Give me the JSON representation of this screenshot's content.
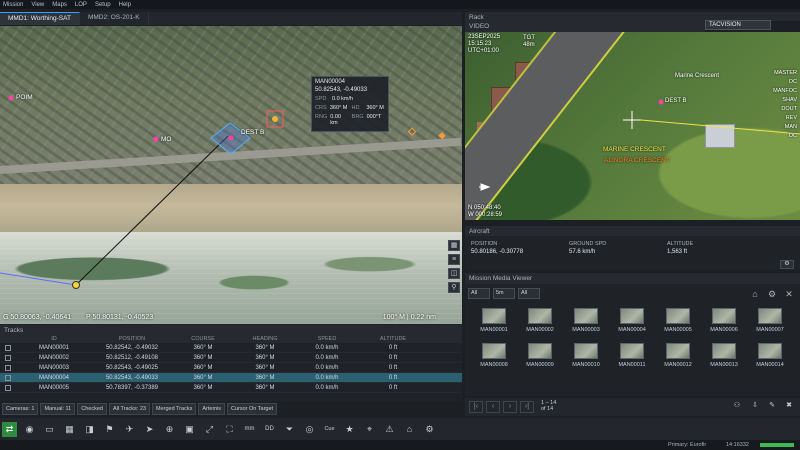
{
  "menu": [
    "Mission",
    "View",
    "Maps",
    "LOP",
    "Setup",
    "Help"
  ],
  "map_tabs": [
    "MMD1: Worthing-SAT",
    "MMD2: OS-201-K"
  ],
  "map": {
    "labels": {
      "poim": "POIM",
      "mo": "MO",
      "dest": "DEST B"
    },
    "popup": {
      "title": "MAN00004",
      "position": "50.82543, -0.49033",
      "spd_k": "SPD",
      "spd_v": "0.0 km/h",
      "crs_k": "CRS",
      "crs_v": "360° M",
      "hd_k": "HD",
      "hd_v": "360° M",
      "rng_k": "RNG",
      "rng_v": "0.00 km",
      "brg_k": "BRG",
      "brg_v": "000°T"
    },
    "coord_left": "G 50.80063, -0.40641",
    "coord_mid": "P 50.80131, -0.40523",
    "coord_right": "100° M | 0.22 nm"
  },
  "rack": {
    "title": "Rack"
  },
  "video": {
    "label": "VIDEO",
    "mode": "TACVISION",
    "top_left_1": "23SEP2025",
    "top_left_2": "15:15:23",
    "top_left_3": "UTC+01:00",
    "tgt": "TGT",
    "tgt_v": "48m",
    "road_label_1": "Marine Crescent",
    "road_label_2": "MARINE CRESCENT",
    "road_label_3": "ALINORA CRESCENT",
    "dest": "DEST B",
    "bottom_1": "N 050:48:40",
    "bottom_2": "W 000:28:59",
    "right_labels": [
      "MASTER",
      "DC",
      "MANFOC",
      "SHAV",
      "DOUT",
      "REV",
      "MAN",
      "DC"
    ]
  },
  "aircraft": {
    "title": "Aircraft",
    "position_k": "POSITION",
    "position_v": "50.80186, -0.30778",
    "speed_k": "GROUND SPD",
    "speed_v": "57.6 km/h",
    "altitude_k": "ALTITUDE",
    "altitude_v": "1,563 ft"
  },
  "media": {
    "title": "Mission Media Viewer",
    "filters": [
      "All",
      "5m",
      "All"
    ],
    "items": [
      "MAN00001",
      "MAN00002",
      "MAN00003",
      "MAN00004",
      "MAN00005",
      "MAN00006",
      "MAN00007",
      "MAN00008",
      "MAN00009",
      "MAN00010",
      "MAN00011",
      "MAN00012",
      "MAN00013",
      "MAN00014"
    ],
    "pager_1": "1 – 14",
    "pager_2": "of 14"
  },
  "tracks": {
    "title": "Tracks",
    "headers": [
      "ID",
      "POSITION",
      "COURSE",
      "HEADING",
      "SPEED",
      "ALTITUDE"
    ],
    "rows": [
      {
        "id": "MAN00001",
        "pos": "50.82542, -0.49032",
        "course": "360° M",
        "heading": "360° M",
        "speed": "0.0 km/h",
        "alt": "0 ft"
      },
      {
        "id": "MAN00002",
        "pos": "50.82512, -0.49108",
        "course": "360° M",
        "heading": "360° M",
        "speed": "0.0 km/h",
        "alt": "0 ft"
      },
      {
        "id": "MAN00003",
        "pos": "50.82543, -0.49025",
        "course": "360° M",
        "heading": "360° M",
        "speed": "0.0 km/h",
        "alt": "0 ft"
      },
      {
        "id": "MAN00004",
        "pos": "50.82543, -0.49033",
        "course": "360° M",
        "heading": "360° M",
        "speed": "0.0 km/h",
        "alt": "0 ft"
      },
      {
        "id": "MAN00005",
        "pos": "50.78397, -0.37389",
        "course": "360° M",
        "heading": "360° M",
        "speed": "0.0 km/h",
        "alt": "0 ft"
      }
    ]
  },
  "track_filters": [
    "Cameras: 1",
    "Manual: 11",
    "Checked",
    "All Tracks: 23",
    "Merged Tracks",
    "Artemis",
    "Cursor On Target"
  ],
  "toolbar": {
    "mm": "mm",
    "dd": "DD",
    "cue": "Cue",
    "icons": [
      "swap-icon",
      "record-icon",
      "screen-icon",
      "grid-icon",
      "camera-icon",
      "flag-icon",
      "plane-icon",
      "pointer-icon",
      "zoom-icon",
      "frame-icon",
      "expand-icon",
      "fit-icon",
      "filter-icon",
      "target-icon",
      "star-icon",
      "crosshair-icon"
    ]
  },
  "status": {
    "primary": "Primary: Eurofir",
    "time": "14:16332"
  }
}
